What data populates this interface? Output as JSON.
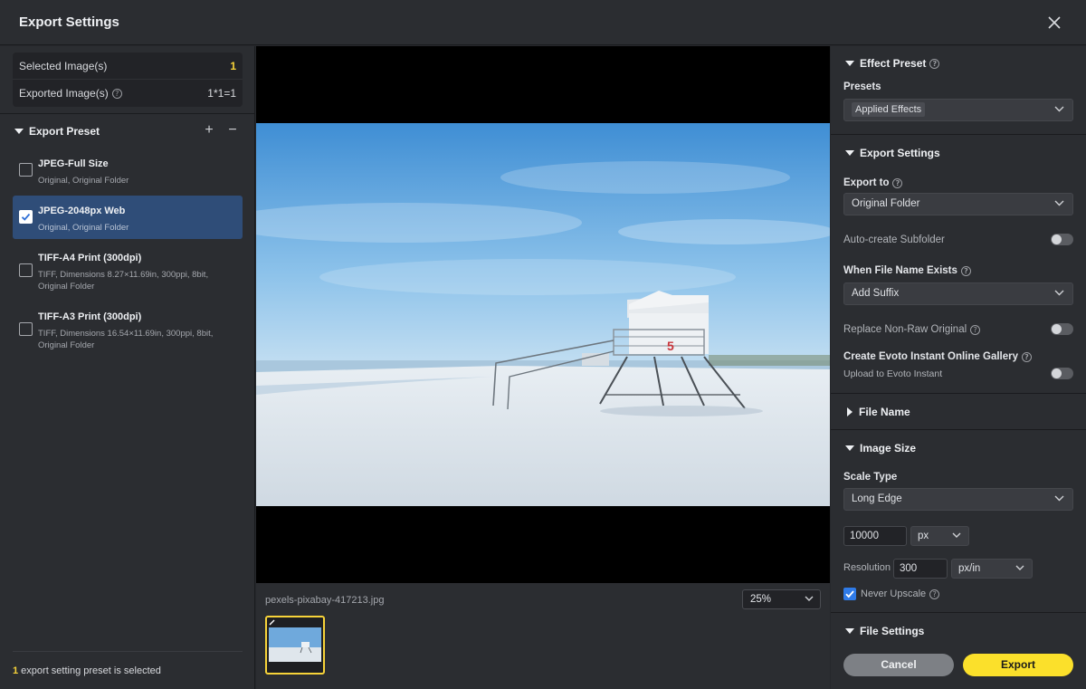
{
  "window": {
    "title": "Export Settings"
  },
  "left": {
    "stats": [
      {
        "label": "Selected Image(s)",
        "value": "1"
      },
      {
        "label": "Exported Image(s)",
        "value": "1*1=1"
      }
    ],
    "export_preset_title": "Export Preset",
    "add_label": "+",
    "remove_label": "−",
    "presets": [
      {
        "name": "JPEG-Full Size",
        "desc1": "Original, Original Folder",
        "desc2": "",
        "checked": false
      },
      {
        "name": "JPEG-2048px Web",
        "desc1": "Original, Original Folder",
        "desc2": "",
        "checked": true
      },
      {
        "name": "TIFF-A4 Print (300dpi)",
        "desc1": "TIFF, Dimensions 8.27×11.69in, 300ppi, 8bit,",
        "desc2": "Original Folder",
        "checked": false
      },
      {
        "name": "TIFF-A3 Print (300dpi)",
        "desc1": "TIFF, Dimensions 16.54×11.69in, 300ppi, 8bit,",
        "desc2": "Original Folder",
        "checked": false
      }
    ],
    "footer_count": "1",
    "footer_text": " export setting preset is selected"
  },
  "center": {
    "filename": "pexels-pixabay-417213.jpg",
    "zoom": "25%",
    "tower_number": "5"
  },
  "right": {
    "effect_preset": {
      "title": "Effect Preset",
      "presets_label": "Presets",
      "presets_value": "Applied Effects"
    },
    "export_settings": {
      "title": "Export Settings",
      "export_to_label": "Export to",
      "export_to_value": "Original Folder",
      "auto_subfolder_label": "Auto-create Subfolder",
      "file_exists_label": "When File Name Exists",
      "file_exists_value": "Add Suffix",
      "replace_label": "Replace Non-Raw Original",
      "gallery_label": "Create Evoto Instant Online Gallery",
      "gallery_sub": "Upload to Evoto Instant"
    },
    "file_name": {
      "title": "File Name"
    },
    "image_size": {
      "title": "Image Size",
      "scale_type_label": "Scale Type",
      "scale_type_value": "Long Edge",
      "size_value": "10000",
      "size_unit": "px",
      "resolution_label": "Resolution",
      "resolution_value": "300",
      "resolution_unit": "px/in",
      "never_upscale_label": "Never Upscale"
    },
    "file_settings": {
      "title": "File Settings"
    },
    "buttons": {
      "cancel": "Cancel",
      "export": "Export"
    }
  },
  "colors": {
    "accent_yellow": "#fbe02b",
    "selected_blue": "#2f4d78",
    "checkbox_blue": "#2f7be8"
  }
}
